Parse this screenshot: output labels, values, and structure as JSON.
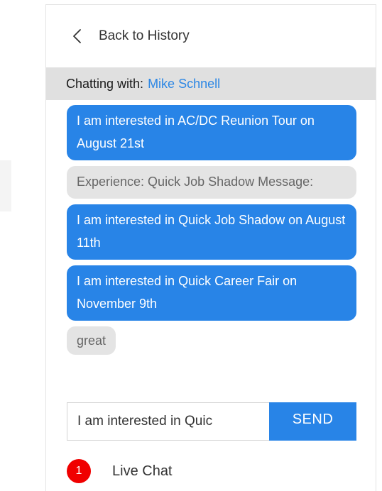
{
  "nav": {
    "back_label": "Back to History"
  },
  "chat": {
    "prefix": "Chatting with:",
    "contact_name": "Mike Schnell"
  },
  "messages": [
    {
      "type": "sent",
      "text": "I am interested in AC/DC Reunion Tour on August 21st"
    },
    {
      "type": "received",
      "text": "Experience: Quick Job Shadow Message:"
    },
    {
      "type": "sent",
      "text": "I am interested in Quick Job Shadow on August 11th"
    },
    {
      "type": "sent",
      "text": "I am interested in Quick Career Fair on November 9th"
    },
    {
      "type": "received",
      "text": "great"
    }
  ],
  "composer": {
    "value": "I am interested in Quic",
    "send_label": "SEND"
  },
  "live_chat": {
    "badge_count": "1",
    "label": "Live Chat"
  },
  "colors": {
    "accent": "#2884e7",
    "badge": "#f00000",
    "header_bg": "#e0e0e0",
    "received_bg": "#e4e4e4"
  }
}
